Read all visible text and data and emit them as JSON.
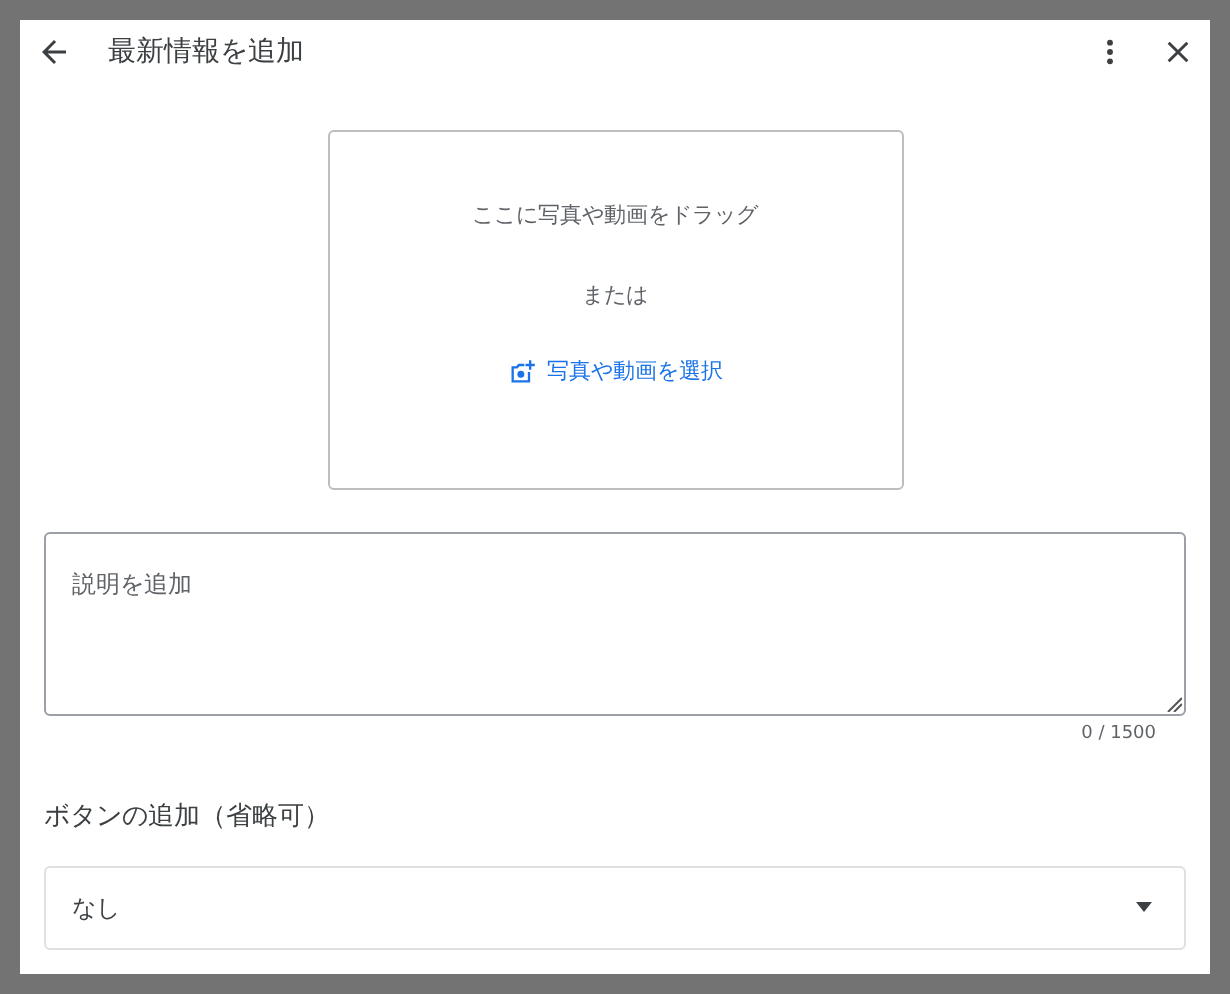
{
  "header": {
    "title": "最新情報を追加"
  },
  "upload": {
    "hint": "ここに写真や動画をドラッグ",
    "or": "または",
    "select_link": "写真や動画を選択"
  },
  "description": {
    "placeholder": "説明を追加",
    "counter": "0 / 1500"
  },
  "button_section": {
    "label": "ボタンの追加（省略可）",
    "value": "なし"
  }
}
